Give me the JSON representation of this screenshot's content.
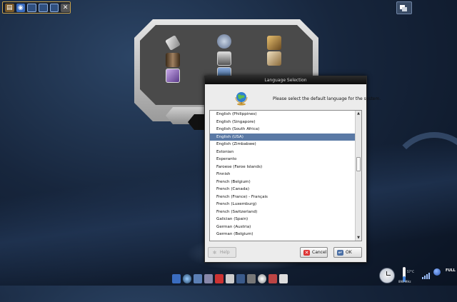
{
  "dialog": {
    "title": "Language Selection",
    "message": "Please select the default language for the system.",
    "languages": [
      "English (Philippines)",
      "English (Singapore)",
      "English (South Africa)",
      "English (USA)",
      "English (Zimbabwe)",
      "Estonian",
      "Esperanto",
      "Faroese (Faroe Islands)",
      "Finnish",
      "French (Belgium)",
      "French (Canada)",
      "French (France)  -  Français",
      "French (Luxemburg)",
      "French (Switzerland)",
      "Galician (Spain)",
      "German (Austria)",
      "German (Belgium)"
    ],
    "selected_index": 3,
    "buttons": {
      "help": "Help",
      "cancel": "Cancel",
      "ok": "OK"
    }
  },
  "tray": {
    "temperature": "57°C",
    "cpu": "898 MHz",
    "battery": "FULL"
  },
  "colors": {
    "selection": "#5a79a5",
    "desktop": "#17263d"
  }
}
